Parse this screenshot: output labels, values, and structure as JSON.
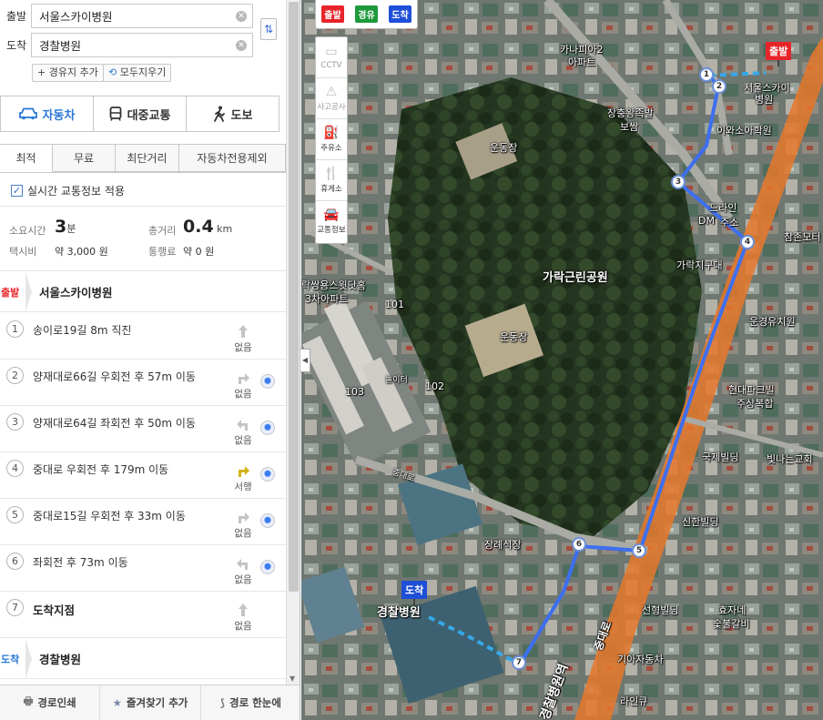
{
  "search": {
    "start_label": "출발",
    "start_value": "서울스카이병원",
    "dest_label": "도착",
    "dest_value": "경찰병원",
    "add_waypoint": "+ 경유지 추가",
    "clear_all": "모두지우기"
  },
  "modes": [
    {
      "label": "자동차",
      "icon": "car-icon",
      "active": true
    },
    {
      "label": "대중교통",
      "icon": "bus-icon",
      "active": false
    },
    {
      "label": "도보",
      "icon": "walk-icon",
      "active": false
    }
  ],
  "route_options": [
    "최적",
    "무료",
    "최단거리",
    "자동차전용제외"
  ],
  "realtime_label": "실시간 교통정보 적용",
  "summary": {
    "time_label": "소요시간",
    "time_value": "3",
    "time_unit": "분",
    "dist_label": "총거리",
    "dist_value": "0.4",
    "dist_unit": "km",
    "taxi_label": "택시비",
    "taxi_value": "약 3,000 원",
    "toll_label": "통행료",
    "toll_value": "약 0 원"
  },
  "start_point": {
    "tag": "출발",
    "name": "서울스카이병원"
  },
  "steps": [
    {
      "num": "1",
      "text": "송이로19길 8m 직진",
      "turn": "straight",
      "turn_label": "없음",
      "cctv": false
    },
    {
      "num": "2",
      "text": "양재대로66길 우회전 후 57m 이동",
      "turn": "right",
      "turn_label": "없음",
      "cctv": true
    },
    {
      "num": "3",
      "text": "양재대로64길 좌회전 후 50m 이동",
      "turn": "left",
      "turn_label": "없음",
      "cctv": true
    },
    {
      "num": "4",
      "text": "중대로 우회전 후 179m 이동",
      "turn": "right-yellow",
      "turn_label": "서행",
      "cctv": true
    },
    {
      "num": "5",
      "text": "중대로15길 우회전 후 33m 이동",
      "turn": "right",
      "turn_label": "없음",
      "cctv": true
    },
    {
      "num": "6",
      "text": "좌회전 후 73m 이동",
      "turn": "left",
      "turn_label": "없음",
      "cctv": true
    },
    {
      "num": "7",
      "text": "도착지점",
      "turn": "straight",
      "turn_label": "없음",
      "cctv": false
    }
  ],
  "end_point": {
    "tag": "도착",
    "name": "경찰병원"
  },
  "bottom": {
    "print": "경로인쇄",
    "favorite": "즐겨찾기 추가",
    "overview": "경로 한눈에"
  },
  "map_flags": {
    "start": "출발",
    "via": "경유",
    "dest": "도착"
  },
  "map_tools": [
    {
      "label": "CCTV",
      "icon": "cctv-icon",
      "active": false
    },
    {
      "label": "사고공사",
      "icon": "accident-icon",
      "active": false
    },
    {
      "label": "주유소",
      "icon": "gas-station-icon",
      "active": true
    },
    {
      "label": "휴게소",
      "icon": "rest-area-icon",
      "active": true
    },
    {
      "label": "교통정보",
      "icon": "traffic-info-icon",
      "active": true
    }
  ],
  "map_labels": {
    "canapia": "카나피아2",
    "apt": "아파트",
    "jangchung1": "장충왕족발",
    "jangchung2": "보쌈",
    "skyhosp1": "서울스카이",
    "skyhosp2": "병원",
    "iwa": "이와소아학원",
    "sports1": "운동장",
    "sports2": "운동장",
    "drive1": "드라인",
    "drive2": "DM",
    "drive3": "주소",
    "garak_police": "가락지구대",
    "park": "가락근린공원",
    "chamjon": "참존모터",
    "apt_name1": "락쌍용스윗닷홈",
    "apt_name2": "3차아파트",
    "bldg101": "101",
    "bldg102": "102",
    "bldg103": "103",
    "playground": "놀이터",
    "unkyung": "운경유치원",
    "hyundai1": "현대파크빌",
    "hyundai2": "주상복합",
    "gukje": "국제빌딩",
    "bitnaneun": "빛나는교회",
    "shinhan": "신한빌딩",
    "jangrye": "장례식장",
    "gyeongchal_hosp": "경찰병원",
    "seonhyung": "선형빌딩",
    "hyoja1": "효자네",
    "hyoja2": "숯불갈비",
    "gia": "기아자동차",
    "raingyu": "라인큐",
    "road_jungdae": "중대로",
    "road_jungdae2": "중대로",
    "station": "경찰병원역"
  },
  "route_nodes": [
    "1",
    "2",
    "3",
    "4",
    "5",
    "6",
    "7"
  ],
  "colors": {
    "accent_blue": "#2a78d6",
    "start_red": "#e8242a",
    "via_green": "#1f9a3b",
    "dest_blue": "#1e4fd8",
    "route_line": "#3d6ff0"
  }
}
